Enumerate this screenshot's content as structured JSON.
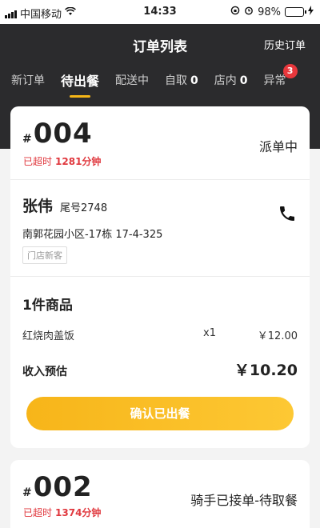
{
  "status_bar": {
    "carrier": "中国移动",
    "time": "14:33",
    "battery": "98%",
    "battery_level": 0.98
  },
  "header": {
    "title": "订单列表",
    "history_label": "历史订单"
  },
  "tabs": [
    {
      "label": "新订单",
      "count": ""
    },
    {
      "label": "待出餐",
      "count": "",
      "active": true
    },
    {
      "label": "配送中",
      "count": ""
    },
    {
      "label": "自取",
      "count": "0"
    },
    {
      "label": "店内",
      "count": "0"
    },
    {
      "label": "异常",
      "count": "",
      "badge": "3"
    }
  ],
  "orders": [
    {
      "hash": "#",
      "number": "004",
      "overtime_label": "已超时",
      "overtime_value": "1281分钟",
      "status": "派单中",
      "customer": {
        "name": "张伟",
        "tail_no": "尾号2748",
        "address": "南郭花园小区-17栋 17-4-325",
        "tag": "门店新客"
      },
      "goods_title": "1件商品",
      "items": [
        {
          "name": "红烧肉盖饭",
          "qty": "x1",
          "price": "￥12.00"
        }
      ],
      "income_label": "收入预估",
      "income_value": "￥10.20",
      "confirm_label": "确认已出餐"
    },
    {
      "hash": "#",
      "number": "002",
      "overtime_label": "已超时",
      "overtime_value": "1374分钟",
      "status": "骑手已接单-待取餐"
    }
  ],
  "colors": {
    "accent": "#f6b617",
    "header_bg": "#2b2b2d",
    "alert_red": "#e0383e"
  }
}
